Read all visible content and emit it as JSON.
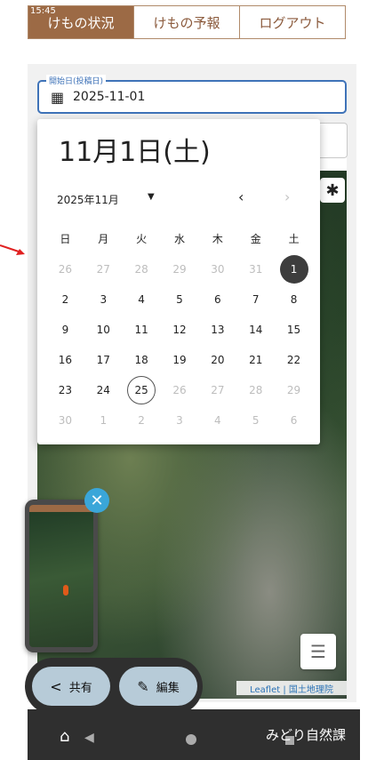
{
  "status": {
    "clock": "15:45"
  },
  "tabs": [
    {
      "label": "けもの状況"
    },
    {
      "label": "けもの予報"
    },
    {
      "label": "ログアウト"
    }
  ],
  "date_field": {
    "label": "開始日(投稿日)",
    "value": "2025-11-01"
  },
  "calendar": {
    "header": "11月1日(土)",
    "month": "2025年11月",
    "weekdays": [
      "日",
      "月",
      "火",
      "水",
      "木",
      "金",
      "土"
    ],
    "weeks": [
      [
        "26",
        "27",
        "28",
        "29",
        "30",
        "31",
        "1"
      ],
      [
        "2",
        "3",
        "4",
        "5",
        "6",
        "7",
        "8"
      ],
      [
        "9",
        "10",
        "11",
        "12",
        "13",
        "14",
        "15"
      ],
      [
        "16",
        "17",
        "18",
        "19",
        "20",
        "21",
        "22"
      ],
      [
        "23",
        "24",
        "25",
        "26",
        "27",
        "28",
        "29"
      ],
      [
        "30",
        "1",
        "2",
        "3",
        "4",
        "5",
        "6"
      ]
    ]
  },
  "actions": {
    "share": "共有",
    "edit": "編集"
  },
  "map": {
    "attribution": "Leaflet | 国土地理院"
  },
  "footer": {
    "brand": "みどり自然課"
  }
}
